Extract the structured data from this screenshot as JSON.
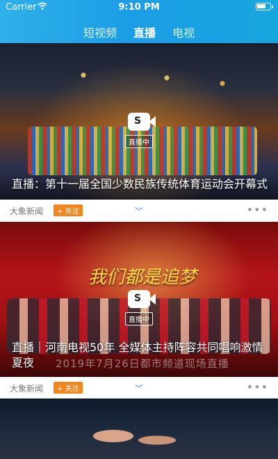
{
  "status_bar": {
    "carrier": "Carrier",
    "time": "9:10 PM"
  },
  "tabs": [
    {
      "label": "短视频",
      "active": false
    },
    {
      "label": "直播",
      "active": true
    },
    {
      "label": "电视",
      "active": false
    }
  ],
  "cards": [
    {
      "title": "直播：第十一届全国少数民族传统体育运动会开幕式",
      "badge": "直播中",
      "source": "大象新闻",
      "follow_label": "+ 关注",
      "more_icon": "•••"
    },
    {
      "title": "直播｜河南电视50年 全媒体主持阵容共同唱响激情夏夜",
      "badge": "直播中",
      "art_title": "我们都是追梦人",
      "banner_text": "2019年7月26日都市频道现场直播",
      "source": "大象新闻",
      "follow_label": "+ 关注",
      "more_icon": "•••"
    }
  ],
  "icons": {
    "chevron": "chevron-down-icon",
    "live": "live-camera-icon",
    "wifi": "wifi-icon",
    "battery": "battery-icon"
  },
  "colors": {
    "header_blue": "#1c9ee6",
    "follow_orange": "#f3861d",
    "chevron_blue": "#3a86d6"
  }
}
